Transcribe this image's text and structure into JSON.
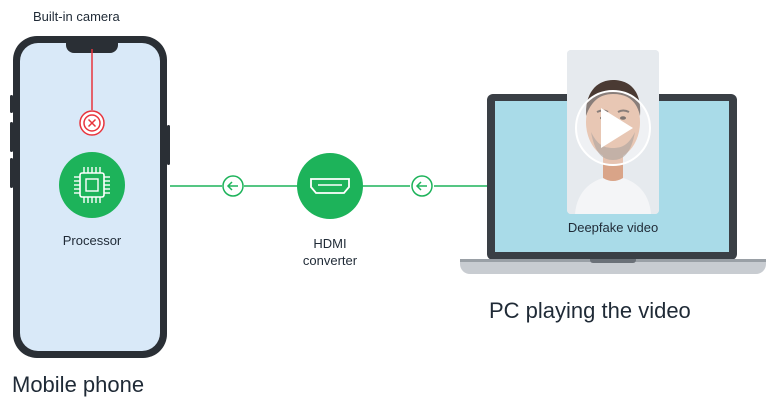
{
  "labels": {
    "camera": "Built-in camera",
    "processor": "Processor",
    "hdmi_line1": "HDMI",
    "hdmi_line2": "converter",
    "video": "Deepfake video",
    "pc_caption": "PC playing the video",
    "phone_caption": "Mobile phone"
  },
  "colors": {
    "accent_green": "#1db35a",
    "block_red": "#e8343d",
    "phone_frame": "#2a2f35",
    "phone_screen": "#d9e9f8",
    "laptop_screen": "#a9dbe8"
  },
  "icons": {
    "processor": "chip-icon",
    "blocked": "close-circle-icon",
    "hdmi": "hdmi-port-icon",
    "flow": "arrow-left-circle-icon",
    "play": "play-icon"
  }
}
